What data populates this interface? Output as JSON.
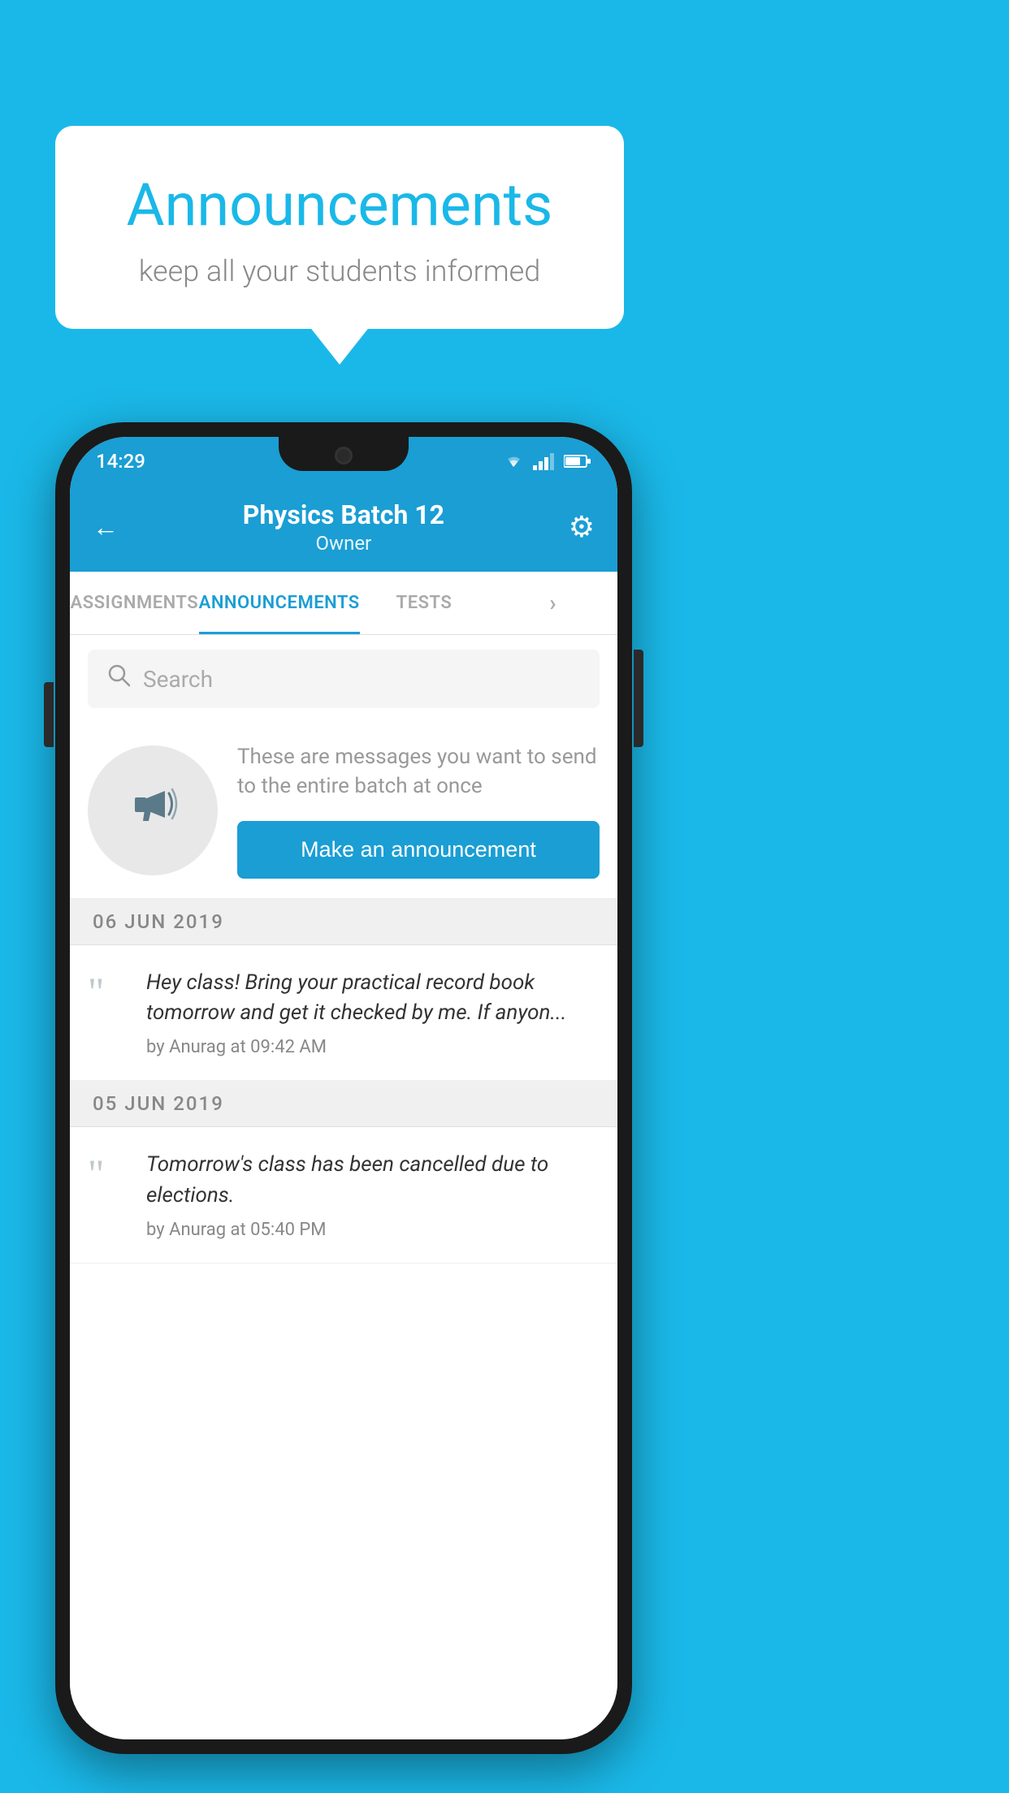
{
  "background_color": "#1ab8e8",
  "bubble": {
    "title": "Announcements",
    "subtitle": "keep all your students informed"
  },
  "status_bar": {
    "time": "14:29",
    "wifi": "▼",
    "signal": "▲",
    "battery": "■"
  },
  "header": {
    "title": "Physics Batch 12",
    "subtitle": "Owner",
    "back_label": "←",
    "settings_label": "⚙"
  },
  "tabs": [
    {
      "label": "ASSIGNMENTS",
      "active": false
    },
    {
      "label": "ANNOUNCEMENTS",
      "active": true
    },
    {
      "label": "TESTS",
      "active": false
    },
    {
      "label": "···",
      "active": false
    }
  ],
  "search": {
    "placeholder": "Search"
  },
  "empty_state": {
    "description": "These are messages you want to send to the entire batch at once",
    "button_label": "Make an announcement"
  },
  "announcements": [
    {
      "date": "06  JUN  2019",
      "text": "Hey class! Bring your practical record book tomorrow and get it checked by me. If anyon...",
      "meta": "by Anurag at 09:42 AM"
    },
    {
      "date": "05  JUN  2019",
      "text": "Tomorrow's class has been cancelled due to elections.",
      "meta": "by Anurag at 05:40 PM"
    }
  ]
}
